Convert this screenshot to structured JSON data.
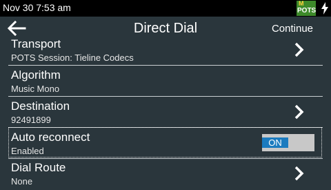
{
  "status": {
    "datetime": "Nov 30 7:53 am",
    "badge_top": "M",
    "badge_text": "POTS"
  },
  "header": {
    "title": "Direct Dial",
    "continue_label": "Continue"
  },
  "rows": [
    {
      "label": "Transport",
      "value": "POTS Session: Tieline Codecs"
    },
    {
      "label": "Algorithm",
      "value": "Music Mono"
    },
    {
      "label": "Destination",
      "value": "92491899"
    },
    {
      "label": "Auto reconnect",
      "value": "Enabled",
      "toggle": "ON"
    },
    {
      "label": "Dial Route",
      "value": "None"
    }
  ],
  "colors": {
    "background": "#2a363c",
    "toggle_on": "#1b7bbf",
    "badge": "#3d8a2a"
  }
}
